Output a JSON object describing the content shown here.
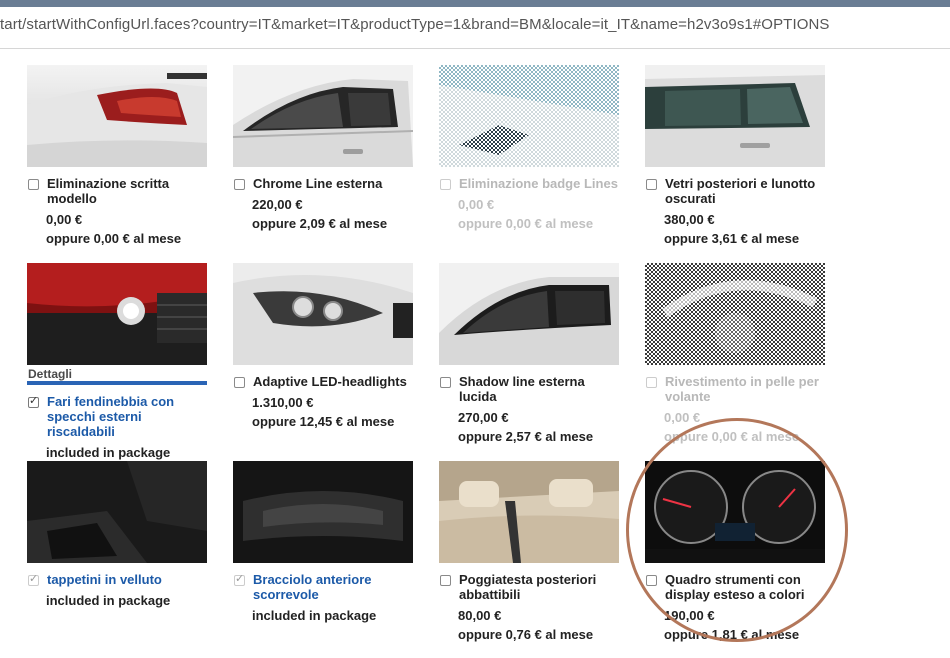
{
  "address_bar": {
    "url": "tart/startWithConfigUrl.faces?country=IT&market=IT&productType=1&brand=BM&locale=it_IT&name=h2v3o9s1#OPTIONS"
  },
  "options": [
    {
      "title": "Eliminazione scritta modello",
      "price": "0,00 €",
      "monthly": "oppure 0,00 € al mese",
      "state": "normal",
      "image": "car-rear-image"
    },
    {
      "title": "Chrome Line esterna",
      "price": "220,00 €",
      "monthly": "oppure 2,09 € al mese",
      "state": "normal",
      "image": "car-window-chrome-image"
    },
    {
      "title": "Eliminazione badge Lines",
      "price": "0,00 €",
      "monthly": "oppure 0,00 € al mese",
      "state": "disabled",
      "image": "badge-image"
    },
    {
      "title": "Vetri posteriori e lunotto oscurati",
      "price": "380,00 €",
      "monthly": "oppure 3,61 € al mese",
      "state": "normal",
      "image": "tinted-windows-image"
    },
    {
      "title": "Fari fendinebbia con specchi esterni riscaldabili",
      "package": "included in package",
      "state": "checked",
      "details": "Dettagli",
      "image": "fog-light-image"
    },
    {
      "title": "Adaptive LED-headlights",
      "price": "1.310,00 €",
      "monthly": "oppure 12,45 € al mese",
      "state": "normal",
      "image": "led-headlight-image"
    },
    {
      "title": "Shadow line esterna lucida",
      "price": "270,00 €",
      "monthly": "oppure 2,57 € al mese",
      "state": "normal",
      "image": "shadow-line-image"
    },
    {
      "title": "Rivestimento in pelle per volante",
      "price": "0,00 €",
      "monthly": "oppure 0,00 € al mese",
      "state": "disabled",
      "image": "steering-wheel-image"
    },
    {
      "title": "tappetini in velluto",
      "package": "included in package",
      "state": "checked-disabled",
      "image": "floor-mats-image"
    },
    {
      "title": "Bracciolo anteriore scorrevole",
      "package": "included in package",
      "state": "checked-disabled",
      "image": "armrest-image"
    },
    {
      "title": "Poggiatesta posteriori abbattibili",
      "price": "80,00 €",
      "monthly": "oppure 0,76 € al mese",
      "state": "normal",
      "image": "headrest-image"
    },
    {
      "title": "Quadro strumenti con display esteso a colori",
      "price": "190,00 €",
      "monthly": "oppure 1,81 € al mese",
      "state": "normal",
      "image": "instrument-cluster-image"
    }
  ],
  "colors": {
    "selected_blue": "#1c5aa8",
    "disabled_grey": "#b8b8b8",
    "annotation_circle": "#b3775a"
  }
}
